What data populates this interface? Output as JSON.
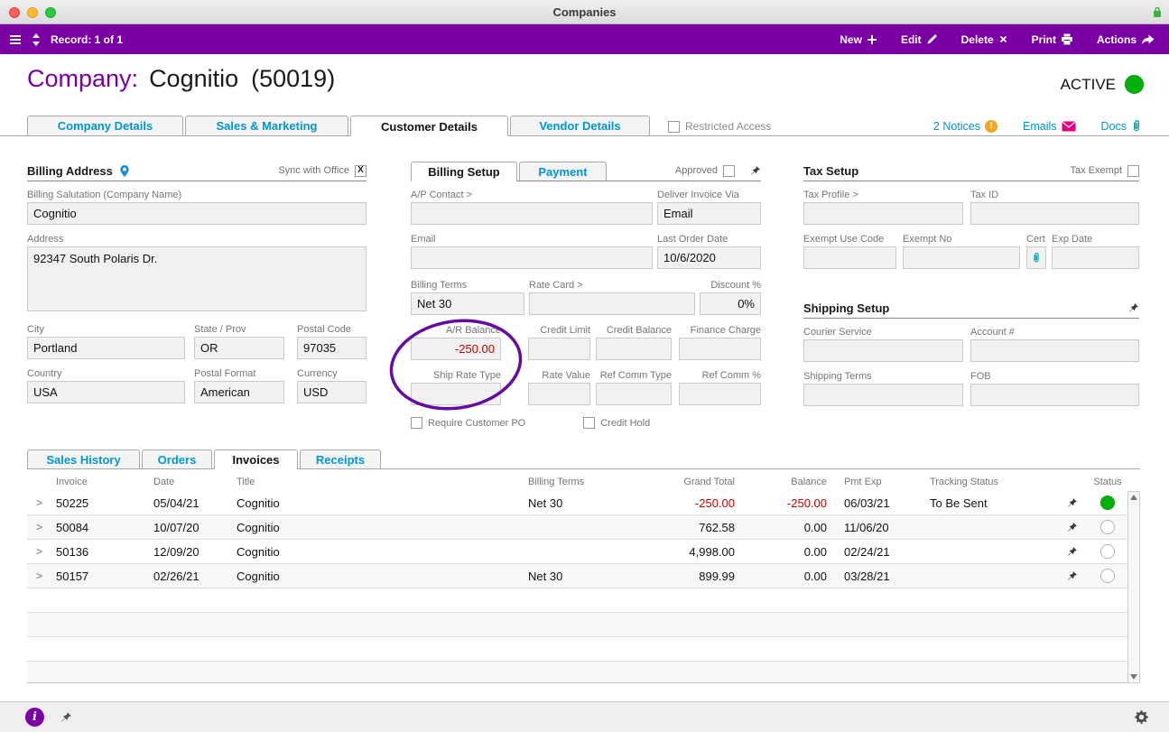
{
  "window": {
    "titlebar": {
      "title": "Companies"
    },
    "toolbar": {
      "record_indicator": "Record: 1 of 1",
      "new_label": "New",
      "edit_label": "Edit",
      "delete_label": "Delete",
      "print_label": "Print",
      "actions_label": "Actions"
    }
  },
  "header": {
    "entity_label": "Company:",
    "entity_name": "Cognitio",
    "entity_number": "(50019)",
    "status_label": "ACTIVE"
  },
  "tabs": {
    "company_details": "Company Details",
    "sales_marketing": "Sales & Marketing",
    "customer_details": "Customer Details",
    "vendor_details": "Vendor Details",
    "restricted_access_label": "Restricted Access",
    "restricted_access_checked": false,
    "notices_label": "2 Notices",
    "emails_label": "Emails",
    "docs_label": "Docs"
  },
  "billing_address": {
    "title": "Billing Address",
    "sync_label": "Sync with Office",
    "sync_checked": true,
    "salutation_label": "Billing Salutation (Company Name)",
    "salutation_value": "Cognitio",
    "address_label": "Address",
    "address_value": "92347 South Polaris Dr.",
    "city_label": "City",
    "city_value": "Portland",
    "state_label": "State / Prov",
    "state_value": "OR",
    "postal_label": "Postal Code",
    "postal_value": "97035",
    "country_label": "Country",
    "country_value": "USA",
    "postal_format_label": "Postal Format",
    "postal_format_value": "American",
    "currency_label": "Currency",
    "currency_value": "USD"
  },
  "billing_setup": {
    "tab_billing": "Billing Setup",
    "tab_payment": "Payment",
    "approved_label": "Approved",
    "approved_checked": false,
    "ap_contact_label": "A/P Contact >",
    "ap_contact_value": "",
    "deliver_via_label": "Deliver Invoice Via",
    "deliver_via_value": "Email",
    "email_label": "Email",
    "email_value": "",
    "last_order_label": "Last Order Date",
    "last_order_value": "10/6/2020",
    "billing_terms_label": "Billing Terms",
    "billing_terms_value": "Net 30",
    "rate_card_label": "Rate Card >",
    "rate_card_value": "",
    "discount_label": "Discount %",
    "discount_value": "0%",
    "ar_balance_label": "A/R Balance",
    "ar_balance_value": "-250.00",
    "credit_limit_label": "Credit Limit",
    "credit_limit_value": "",
    "credit_balance_label": "Credit Balance",
    "credit_balance_value": "",
    "finance_charge_label": "Finance Charge",
    "finance_charge_value": "",
    "ship_rate_type_label": "Ship Rate Type",
    "ship_rate_type_value": "",
    "rate_value_label": "Rate Value",
    "rate_value_value": "",
    "ref_comm_type_label": "Ref Comm Type",
    "ref_comm_type_value": "",
    "ref_comm_pct_label": "Ref Comm %",
    "ref_comm_pct_value": "",
    "require_po_label": "Require Customer PO",
    "require_po_checked": false,
    "credit_hold_label": "Credit Hold",
    "credit_hold_checked": false
  },
  "tax_setup": {
    "title": "Tax Setup",
    "tax_exempt_label": "Tax Exempt",
    "tax_exempt_checked": false,
    "tax_profile_label": "Tax Profile >",
    "tax_profile_value": "",
    "tax_id_label": "Tax ID",
    "tax_id_value": "",
    "exempt_use_label": "Exempt Use Code",
    "exempt_use_value": "",
    "exempt_no_label": "Exempt No",
    "exempt_no_value": "",
    "cert_label": "Cert",
    "exp_date_label": "Exp Date",
    "exp_date_value": ""
  },
  "shipping_setup": {
    "title": "Shipping Setup",
    "courier_label": "Courier Service",
    "courier_value": "",
    "account_label": "Account #",
    "account_value": "",
    "terms_label": "Shipping Terms",
    "terms_value": "",
    "fob_label": "FOB",
    "fob_value": ""
  },
  "portal": {
    "tab_sales_history": "Sales History",
    "tab_orders": "Orders",
    "tab_invoices": "Invoices",
    "tab_receipts": "Receipts",
    "columns": {
      "invoice": "Invoice",
      "date": "Date",
      "title": "Title",
      "terms": "Billing Terms",
      "grand_total": "Grand Total",
      "balance": "Balance",
      "pmt_exp": "Pmt Exp",
      "tracking": "Tracking Status",
      "status": "Status"
    },
    "rows": [
      {
        "invoice": "50225",
        "date": "05/04/21",
        "title": "Cognitio",
        "terms": "Net 30",
        "grand_total": "-250.00",
        "balance": "-250.00",
        "pmt_exp": "06/03/21",
        "tracking": "To Be Sent",
        "negative": true,
        "status_filled": true
      },
      {
        "invoice": "50084",
        "date": "10/07/20",
        "title": "Cognitio",
        "terms": "",
        "grand_total": "762.58",
        "balance": "0.00",
        "pmt_exp": "11/06/20",
        "tracking": "",
        "negative": false,
        "status_filled": false
      },
      {
        "invoice": "50136",
        "date": "12/09/20",
        "title": "Cognitio",
        "terms": "",
        "grand_total": "4,998.00",
        "balance": "0.00",
        "pmt_exp": "02/24/21",
        "tracking": "",
        "negative": false,
        "status_filled": false
      },
      {
        "invoice": "50157",
        "date": "02/26/21",
        "title": "Cognitio",
        "terms": "Net 30",
        "grand_total": "899.99",
        "balance": "0.00",
        "pmt_exp": "03/28/21",
        "tracking": "",
        "negative": false,
        "status_filled": false
      }
    ]
  },
  "colors": {
    "brand_purple": "#7A00A3",
    "link_blue": "#0096D6",
    "negative_red": "#C80000",
    "status_green": "#00B20B",
    "annotation_purple": "#650DA0",
    "email_magenta": "#E5007D",
    "paperclip_teal": "#00A3B5",
    "notice_orange": "#F5A623"
  }
}
